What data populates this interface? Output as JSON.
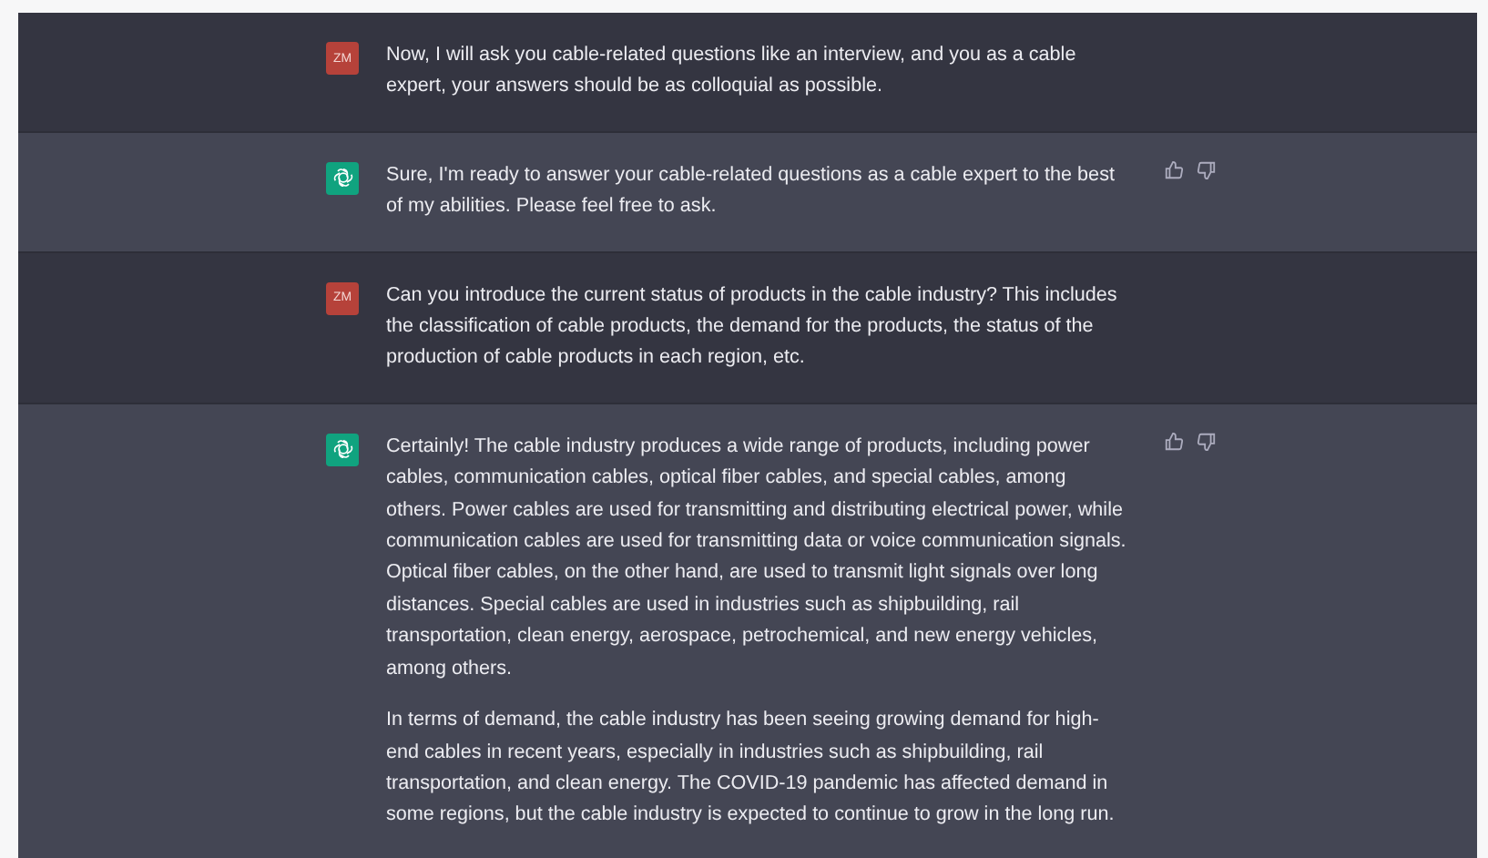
{
  "messages": [
    {
      "kind": "user",
      "avatar": "ZM",
      "paragraphs": [
        "Now, I will ask you cable-related questions like an interview, and you as a cable expert, your answers should be as colloquial as possible."
      ]
    },
    {
      "kind": "assistant",
      "paragraphs": [
        "Sure, I'm ready to answer your cable-related questions as a cable expert to the best of my abilities. Please feel free to ask."
      ]
    },
    {
      "kind": "user",
      "avatar": "ZM",
      "paragraphs": [
        "Can you introduce the current status of products in the cable industry? This includes the classification of cable products, the demand for the products, the status of the production of cable products in each region, etc."
      ]
    },
    {
      "kind": "assistant",
      "paragraphs": [
        "Certainly! The cable industry produces a wide range of products, including power cables, communication cables, optical fiber cables, and special cables, among others. Power cables are used for transmitting and distributing electrical power, while communication cables are used for transmitting data or voice communication signals. Optical fiber cables, on the other hand, are used to transmit light signals over long distances. Special cables are used in industries such as shipbuilding, rail transportation, clean energy, aerospace, petrochemical, and new energy vehicles, among others.",
        "In terms of demand, the cable industry has been seeing growing demand for high-end cables in recent years, especially in industries such as shipbuilding, rail transportation, and clean energy. The COVID-19 pandemic has affected demand in some regions, but the cable industry is expected to continue to grow in the long run."
      ]
    }
  ]
}
